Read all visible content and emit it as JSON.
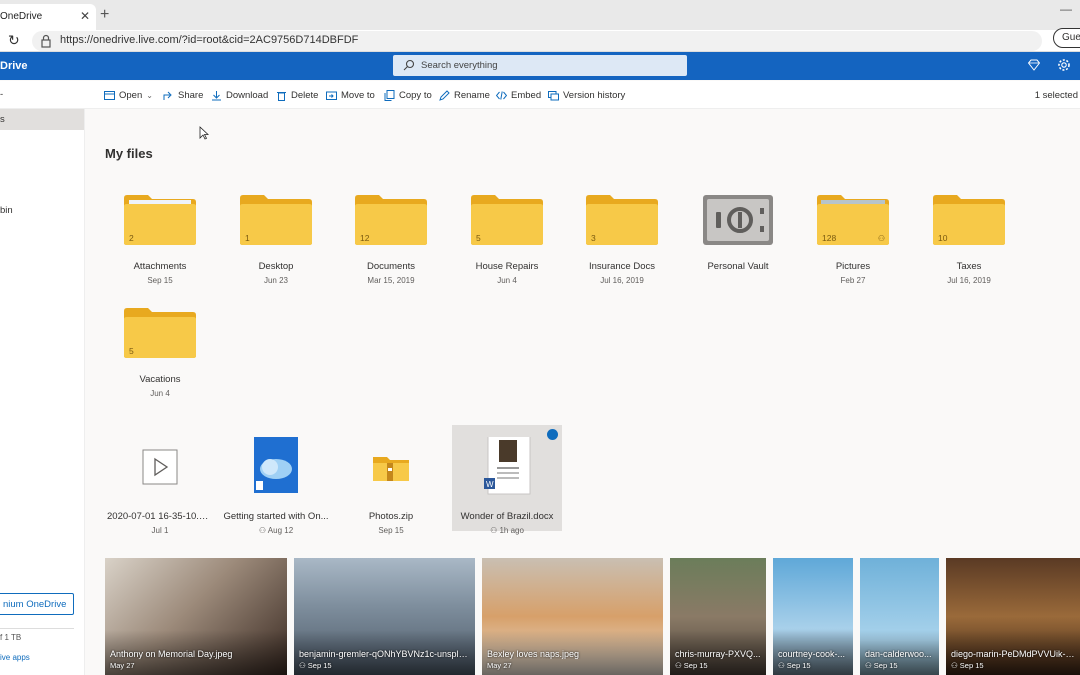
{
  "browser": {
    "tab_title": "OneDrive",
    "tab_close": "✕",
    "new_tab": "+",
    "url": "https://onedrive.live.com/?id=root&cid=2AC9756D714DBFDF",
    "profile": "Gues"
  },
  "header": {
    "brand": "Drive",
    "search_placeholder": "Search everything"
  },
  "commands": {
    "open": "Open",
    "share": "Share",
    "download": "Download",
    "delete": "Delete",
    "move_to": "Move to",
    "copy_to": "Copy to",
    "rename": "Rename",
    "embed": "Embed",
    "version_history": "Version history",
    "selected_count": "1 selected"
  },
  "leftnav": {
    "arrow_item": "-",
    "selected_item": "s",
    "bin_item": "bin",
    "premium_button": "nium OneDrive",
    "storage": "f 1 TB",
    "apps_link": "ive apps"
  },
  "main": {
    "title": "My files",
    "folders": [
      {
        "name": "Attachments",
        "date": "Sep 15",
        "count": "2"
      },
      {
        "name": "Desktop",
        "date": "Jun 23",
        "count": "1"
      },
      {
        "name": "Documents",
        "date": "Mar 15, 2019",
        "count": "12"
      },
      {
        "name": "House Repairs",
        "date": "Jun 4",
        "count": "5"
      },
      {
        "name": "Insurance Docs",
        "date": "Jul 16, 2019",
        "count": "3"
      },
      {
        "name": "Personal Vault",
        "date": ""
      },
      {
        "name": "Pictures",
        "date": "Feb 27",
        "count": "128"
      },
      {
        "name": "Taxes",
        "date": "Jul 16, 2019",
        "count": "10"
      },
      {
        "name": "Vacations",
        "date": "Jun 4",
        "count": "5"
      }
    ],
    "files": [
      {
        "name": "2020-07-01 16-35-10.m...",
        "date": "Jul 1"
      },
      {
        "name": "Getting started with On...",
        "date": "Aug 12"
      },
      {
        "name": "Photos.zip",
        "date": "Sep 15"
      },
      {
        "name": "Wonder of Brazil.docx",
        "date": "1h ago"
      }
    ],
    "photos": [
      {
        "name": "Anthony on Memorial Day.jpeg",
        "date": "May 27"
      },
      {
        "name": "benjamin-gremler-qONhYBVNz1c-unspla...",
        "date": "Sep 15"
      },
      {
        "name": "Bexley loves naps.jpeg",
        "date": "May 27"
      },
      {
        "name": "chris-murray-PXVQ...",
        "date": "Sep 15"
      },
      {
        "name": "courtney-cook-...",
        "date": "Sep 15"
      },
      {
        "name": "dan-calderwoo...",
        "date": "Sep 15"
      },
      {
        "name": "diego-marin-PeDMdPVVUik-unsp",
        "date": "Sep 15"
      }
    ]
  },
  "colors": {
    "brand_blue": "#1464c0",
    "folder_yellow": "#f7c948",
    "folder_back": "#e8a91f",
    "selected_bg": "#e1dfdd"
  }
}
